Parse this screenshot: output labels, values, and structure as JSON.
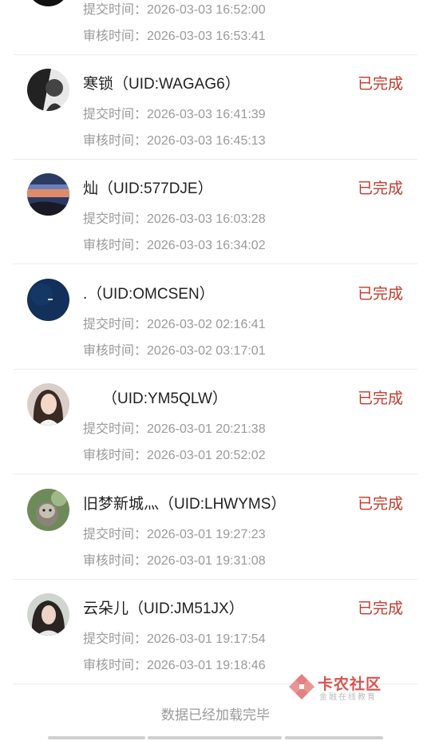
{
  "status_color": "#c0392b",
  "records": [
    {
      "name": "",
      "submit_label": "提交时间：",
      "submit_time": "2026-03-03 16:52:00",
      "review_label": "审核时间：",
      "review_time": "2026-03-03 16:53:41",
      "status": ""
    },
    {
      "name": "寒锁（UID:WAGAG6）",
      "submit_label": "提交时间：",
      "submit_time": "2026-03-03 16:41:39",
      "review_label": "审核时间：",
      "review_time": "2026-03-03 16:45:13",
      "status": "已完成"
    },
    {
      "name": "灿（UID:577DJE）",
      "submit_label": "提交时间：",
      "submit_time": "2026-03-03 16:03:28",
      "review_label": "审核时间：",
      "review_time": "2026-03-03 16:34:02",
      "status": "已完成"
    },
    {
      "name": ".（UID:OMCSEN）",
      "submit_label": "提交时间：",
      "submit_time": "2026-03-02 02:16:41",
      "review_label": "审核时间：",
      "review_time": "2026-03-02 03:17:01",
      "status": "已完成"
    },
    {
      "name": "（UID:YM5QLW）",
      "submit_label": "提交时间：",
      "submit_time": "2026-03-01 20:21:38",
      "review_label": "审核时间：",
      "review_time": "2026-03-01 20:52:02",
      "status": "已完成"
    },
    {
      "name": "旧梦新城灬（UID:LHWYMS）",
      "submit_label": "提交时间：",
      "submit_time": "2026-03-01 19:27:23",
      "review_label": "审核时间：",
      "review_time": "2026-03-01 19:31:08",
      "status": "已完成"
    },
    {
      "name": "云朵儿（UID:JM51JX）",
      "submit_label": "提交时间：",
      "submit_time": "2026-03-01 19:17:54",
      "review_label": "审核时间：",
      "review_time": "2026-03-01 19:18:46",
      "status": "已完成"
    }
  ],
  "footer_text": "数据已经加载完毕",
  "watermark": {
    "title": "卡农社区",
    "subtitle": "金融在线教育"
  }
}
